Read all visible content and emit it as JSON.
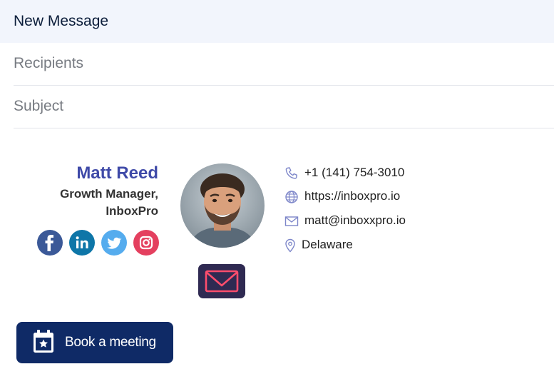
{
  "compose": {
    "title": "New Message",
    "recipients_placeholder": "Recipients",
    "subject_placeholder": "Subject"
  },
  "signature": {
    "name": "Matt Reed",
    "role_line1": "Growth Manager,",
    "role_line2": "InboxPro",
    "social": [
      {
        "icon": "facebook-icon",
        "color": "#3b5998"
      },
      {
        "icon": "linkedin-icon",
        "color": "#0e76a8"
      },
      {
        "icon": "twitter-icon",
        "color": "#55acee"
      },
      {
        "icon": "instagram-icon",
        "color": "#e4405f"
      }
    ],
    "contacts": {
      "phone": "+1 (141) 754-3010",
      "website": "https://inboxpro.io",
      "email": "matt@inboxxpro.io",
      "location": "Delaware"
    },
    "cta_label": "Book a meeting",
    "colors": {
      "name": "#3f4aa8",
      "button_bg": "#0f2a66",
      "mail_badge": "#2f2a52",
      "mail_envelope": "#ff4d6d",
      "contact_icon": "#7d86c9"
    }
  }
}
